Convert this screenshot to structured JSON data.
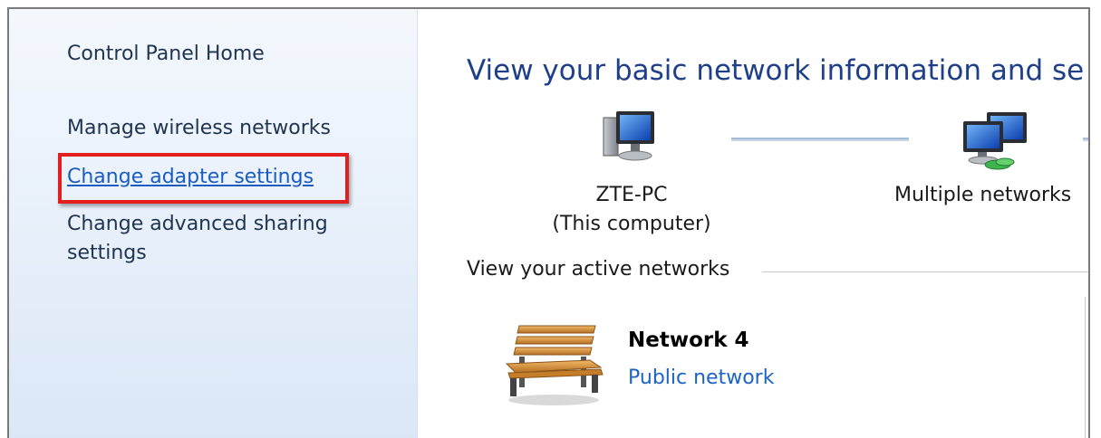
{
  "sidebar": {
    "items": [
      {
        "label": "Control Panel Home"
      },
      {
        "label": "Manage wireless networks"
      },
      {
        "label": "Change adapter settings"
      },
      {
        "label": "Change advanced sharing"
      },
      {
        "label": "settings"
      }
    ]
  },
  "main": {
    "heading": "View your basic network information and se",
    "map": {
      "computer": {
        "name": "ZTE-PC",
        "sub": "(This computer)",
        "icon": "computer-icon"
      },
      "network": {
        "name": "Multiple networks",
        "icon": "multiple-networks-icon"
      }
    },
    "active_section_title": "View your active networks",
    "active_network": {
      "name": "Network  4",
      "type": "Public network",
      "icon": "park-bench-icon"
    }
  },
  "colors": {
    "heading": "#1e3f8a",
    "link": "#1b5cc0",
    "highlight": "#e41e1e"
  }
}
